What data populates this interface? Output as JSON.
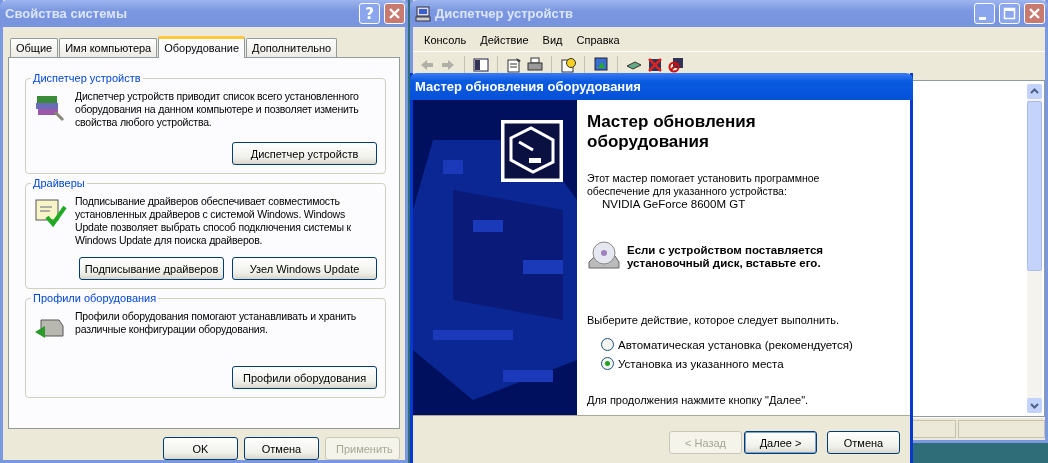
{
  "system_properties": {
    "title": "Свойства системы",
    "help_button": "?",
    "tabs": [
      {
        "label": "Общие",
        "selected": false
      },
      {
        "label": "Имя компьютера",
        "selected": false
      },
      {
        "label": "Оборудование",
        "selected": true
      },
      {
        "label": "Дополнительно",
        "selected": false
      }
    ],
    "groups": [
      {
        "title": "Диспетчер устройств",
        "text": "Диспетчер устройств приводит список всего установленного оборудования на данном компьютере и позволяет изменить свойства любого устройства.",
        "buttons": [
          "Диспетчер устройств"
        ]
      },
      {
        "title": "Драйверы",
        "text": "Подписывание драйверов обеспечивает совместимость установленных драйверов с системой Windows.  Windows Update позволяет выбрать способ подключения системы к Windows Update для поиска драйверов.",
        "buttons": [
          "Подписывание драйверов",
          "Узел Windows Update"
        ]
      },
      {
        "title": "Профили оборудования",
        "text": "Профили оборудования помогают устанавливать и хранить различные конфигурации оборудования.",
        "buttons": [
          "Профили оборудования"
        ]
      }
    ],
    "footer_buttons": [
      {
        "label": "OK",
        "disabled": false
      },
      {
        "label": "Отмена",
        "disabled": false
      },
      {
        "label": "Применить",
        "disabled": true
      }
    ]
  },
  "device_manager": {
    "title": "Диспетчер устройств",
    "menu": [
      "Консоль",
      "Действие",
      "Вид",
      "Справка"
    ]
  },
  "wizard": {
    "title": "Мастер обновления оборудования",
    "heading": "Мастер обновления оборудования",
    "intro": "Этот мастер помогает установить программное обеспечение для указанного устройства:",
    "device": "NVIDIA GeForce 8600M GT",
    "note": "Если с устройством поставляется установочный диск, вставьте его.",
    "prompt": "Выберите действие, которое следует выполнить.",
    "options": [
      {
        "label": "Автоматическая установка (рекомендуется)",
        "selected": false
      },
      {
        "label": "Установка из указанного места",
        "selected": true
      }
    ],
    "continue_text": "Для продолжения нажмите кнопку \"Далее\".",
    "buttons": [
      {
        "label": "< Назад",
        "disabled": true
      },
      {
        "label": "Далее >",
        "disabled": false
      },
      {
        "label": "Отмена",
        "disabled": false
      }
    ]
  }
}
